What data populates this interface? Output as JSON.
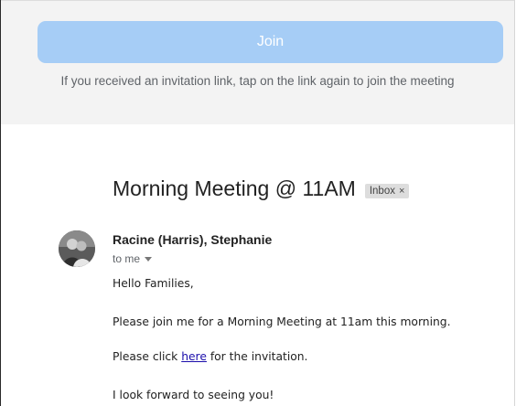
{
  "join_panel": {
    "button_label": "Join",
    "hint": "If you received an invitation link, tap on the link again to join the meeting"
  },
  "email": {
    "subject": "Morning Meeting @ 11AM",
    "label": "Inbox",
    "label_close": "×",
    "sender": "Racine (Harris), Stephanie",
    "recipient": "to me",
    "body": {
      "greeting": "Hello Families,",
      "line1": "Please join me for a Morning Meeting at 11am this morning.",
      "line2_before": "Please click ",
      "line2_link": "here",
      "line2_after": " for the invitation.",
      "line3": "I look forward to seeing you!"
    }
  },
  "colors": {
    "join_button": "#a6cdf6",
    "panel_bg": "#f3f3f3",
    "link": "#1a0dab"
  }
}
